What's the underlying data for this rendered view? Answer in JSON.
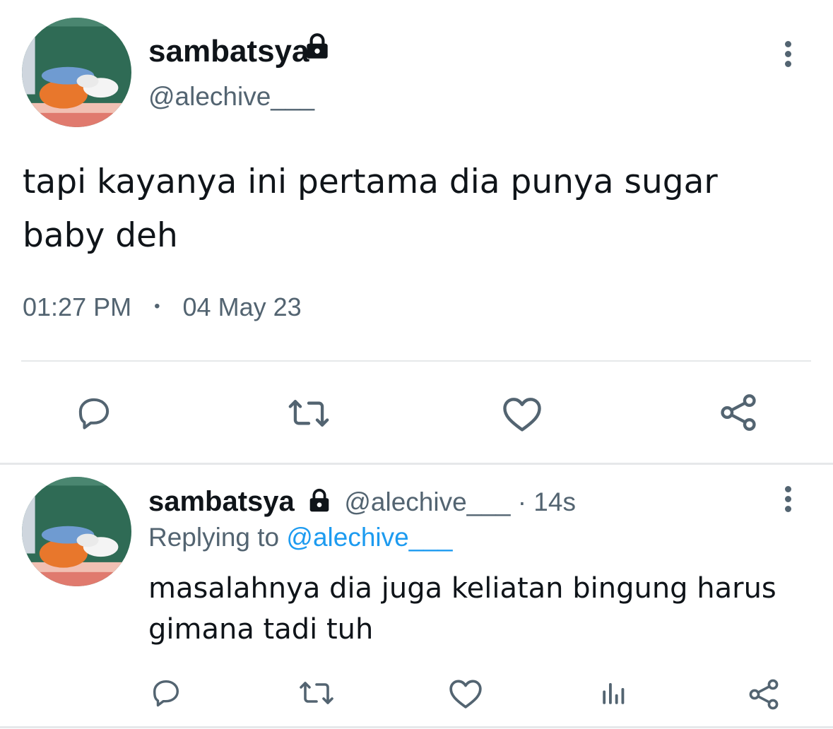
{
  "main_tweet": {
    "display_name": "sambatsya",
    "handle": "@alechive___",
    "text": "tapi kayanya ini pertama dia punya sugar\nbaby deh",
    "time": "01:27 PM",
    "separator": "•",
    "date": "04 May 23",
    "actions": [
      {
        "icon": "reply-icon"
      },
      {
        "icon": "retweet-icon"
      },
      {
        "icon": "heart-icon"
      },
      {
        "icon": "share-icon"
      }
    ]
  },
  "reply_tweet": {
    "display_name": "sambatsya",
    "handle": "@alechive___",
    "age": "· 14s",
    "replying_prefix": "Replying to",
    "replying_handle": "@alechive___",
    "text": "masalahnya dia juga keliatan bingung harus\ngimana tadi tuh",
    "actions": [
      {
        "icon": "reply-icon"
      },
      {
        "icon": "retweet-icon"
      },
      {
        "icon": "heart-icon"
      },
      {
        "icon": "analytics-icon"
      },
      {
        "icon": "share-icon"
      }
    ]
  },
  "colors": {
    "text": "#0f1419",
    "secondary": "#536471",
    "link": "#1d9bf0",
    "divider": "#e6e8ea"
  }
}
